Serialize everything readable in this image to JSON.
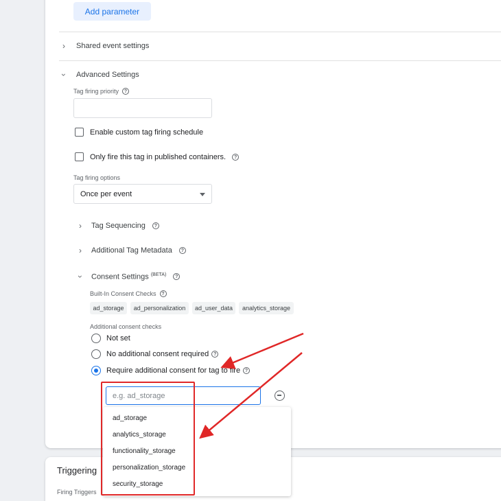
{
  "add_parameter_label": "Add parameter",
  "shared_event_settings": "Shared event settings",
  "advanced_settings": {
    "title": "Advanced Settings",
    "tag_firing_priority_label": "Tag firing priority",
    "tag_firing_priority_value": "",
    "custom_schedule_label": "Enable custom tag firing schedule",
    "custom_schedule_checked": false,
    "published_only_label": "Only fire this tag in published containers.",
    "published_only_checked": false,
    "tag_firing_options_label": "Tag firing options",
    "tag_firing_options_value": "Once per event",
    "tag_sequencing": "Tag Sequencing",
    "additional_metadata": "Additional Tag Metadata",
    "consent_settings": "Consent Settings",
    "consent_beta": "(BETA)"
  },
  "consent": {
    "built_in_label": "Built-In Consent Checks",
    "built_in_chips": [
      "ad_storage",
      "ad_personalization",
      "ad_user_data",
      "analytics_storage"
    ],
    "additional_label": "Additional consent checks",
    "options": [
      {
        "label": "Not set",
        "selected": false
      },
      {
        "label": "No additional consent required",
        "selected": false
      },
      {
        "label": "Require additional consent for tag to fire",
        "selected": true
      }
    ],
    "input_placeholder": "e.g. ad_storage",
    "suggestions": [
      "ad_storage",
      "analytics_storage",
      "functionality_storage",
      "personalization_storage",
      "security_storage"
    ]
  },
  "triggering": {
    "title": "Triggering",
    "firing_triggers_label": "Firing Triggers"
  },
  "colors": {
    "accent": "#1a73e8",
    "annotation_red": "#e02727"
  }
}
